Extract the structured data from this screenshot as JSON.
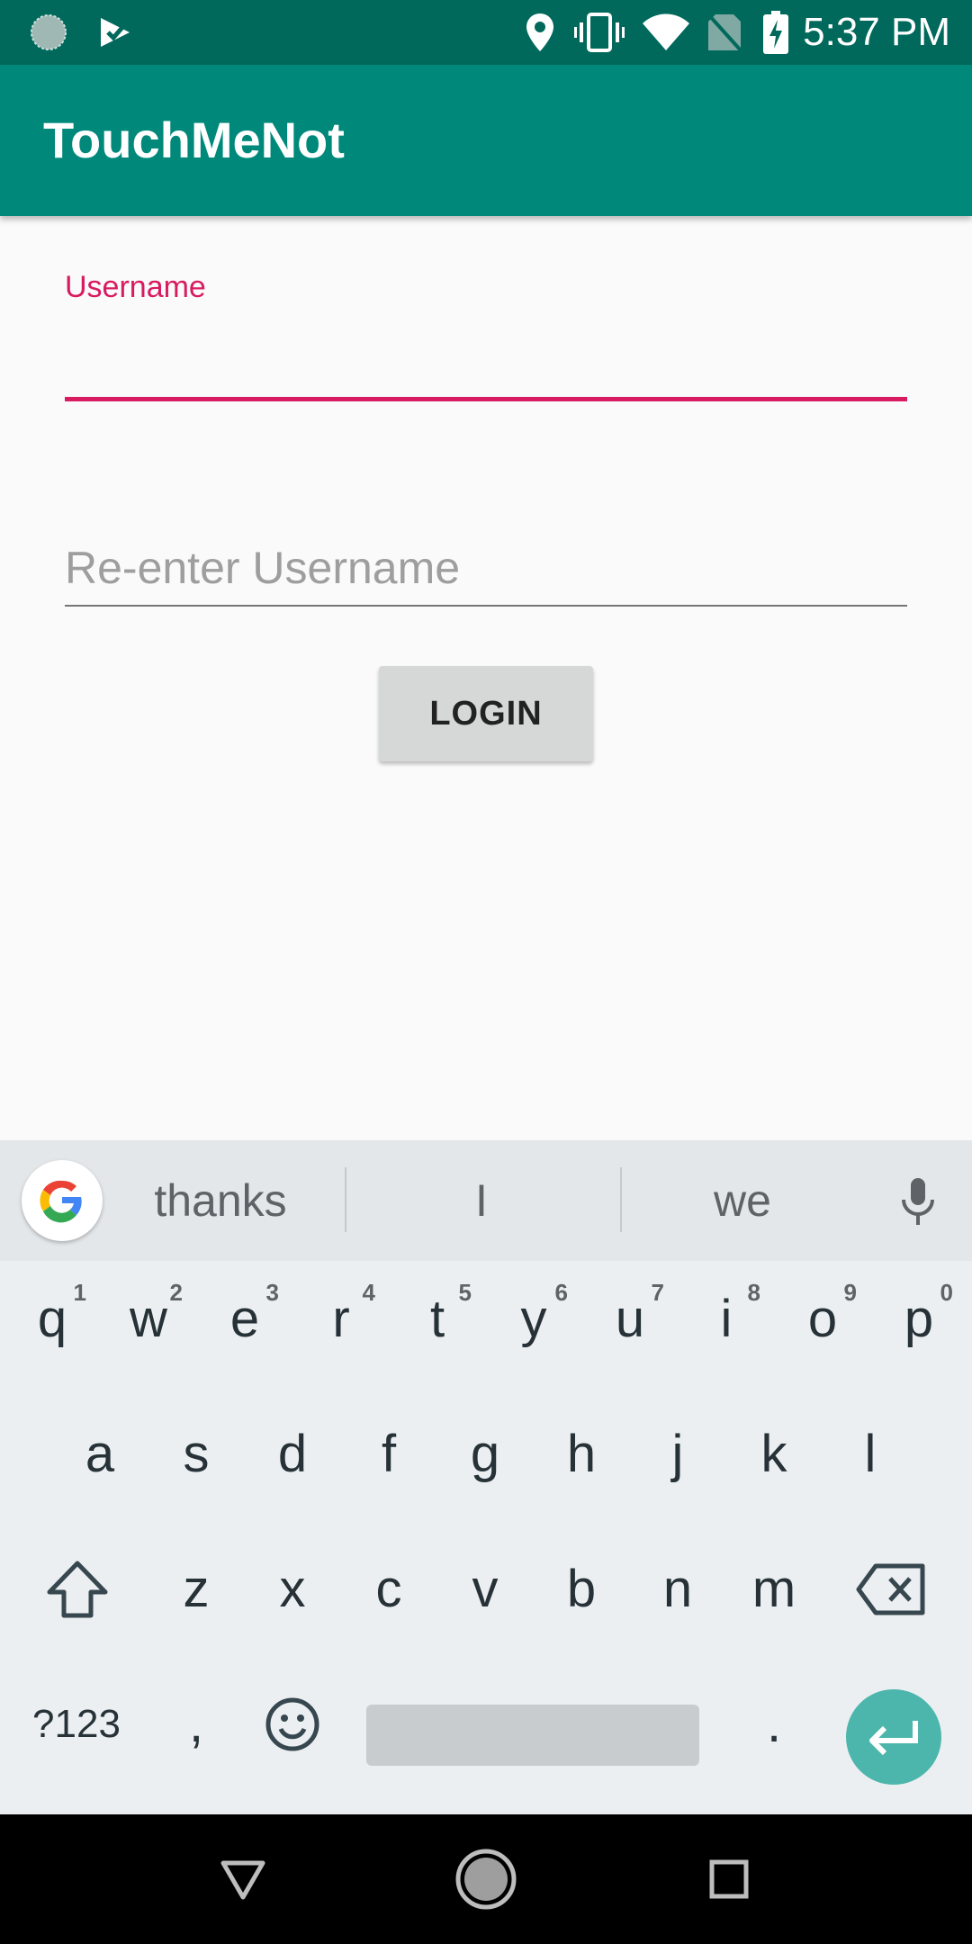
{
  "status_bar": {
    "time": "5:37 PM"
  },
  "app_bar": {
    "title": "TouchMeNot"
  },
  "form": {
    "username_label": "Username",
    "username_value": "",
    "reenter_placeholder": "Re-enter Username",
    "reenter_value": "",
    "login_label": "LOGIN"
  },
  "keyboard": {
    "suggestions": [
      "thanks",
      "I",
      "we"
    ],
    "row1": [
      {
        "key": "q",
        "hint": "1"
      },
      {
        "key": "w",
        "hint": "2"
      },
      {
        "key": "e",
        "hint": "3"
      },
      {
        "key": "r",
        "hint": "4"
      },
      {
        "key": "t",
        "hint": "5"
      },
      {
        "key": "y",
        "hint": "6"
      },
      {
        "key": "u",
        "hint": "7"
      },
      {
        "key": "i",
        "hint": "8"
      },
      {
        "key": "o",
        "hint": "9"
      },
      {
        "key": "p",
        "hint": "0"
      }
    ],
    "row2": [
      "a",
      "s",
      "d",
      "f",
      "g",
      "h",
      "j",
      "k",
      "l"
    ],
    "row3": [
      "z",
      "x",
      "c",
      "v",
      "b",
      "n",
      "m"
    ],
    "symbols_label": "?123",
    "comma": ",",
    "period": "."
  },
  "colors": {
    "status_bar": "#00695c",
    "app_bar": "#00897b",
    "accent": "#d81b60",
    "enter_key": "#4db6ac"
  }
}
